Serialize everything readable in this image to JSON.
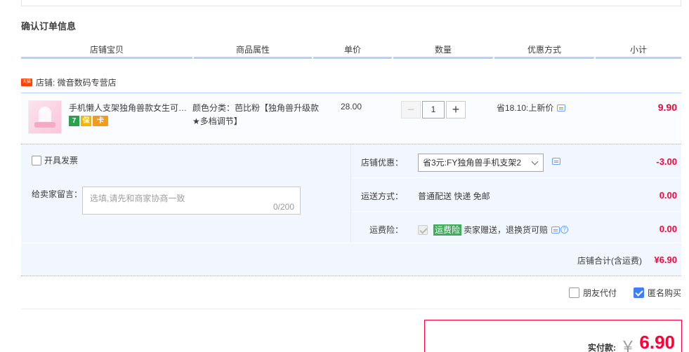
{
  "section_title": "确认订单信息",
  "columns": [
    "店铺宝贝",
    "商品属性",
    "单价",
    "数量",
    "优惠方式",
    "小计"
  ],
  "shop": {
    "badge": "天猫",
    "label": "店铺: 微音数码专营店"
  },
  "item": {
    "title": "手机懒人支架独角兽款女生可爱桌面少女心",
    "icons": [
      "7",
      "保",
      "卡"
    ],
    "attributes": "颜色分类：芭比粉【独角兽升级款★多档调节】",
    "price": "28.00",
    "quantity": "1",
    "discount": "省18.10:上新价",
    "subtotal": "9.90"
  },
  "invoice_label": "开具发票",
  "message": {
    "label": "给卖家留言：",
    "placeholder": "选填,请先和商家协商一致",
    "count": "0/200"
  },
  "shop_discount": {
    "label": "店铺优惠：",
    "selected": "省3元:FY独角兽手机支架2",
    "amount": "-3.00"
  },
  "shipping": {
    "label": "运送方式：",
    "value": "普通配送 快递 免邮",
    "amount": "0.00"
  },
  "insurance": {
    "label": "运费险：",
    "badge": "运费险",
    "value": "卖家赠送，退换货可赔",
    "help": "?",
    "amount": "0.00"
  },
  "shop_total": {
    "label": "店铺合计(含运费)",
    "value": "¥6.90"
  },
  "options": {
    "friend_pay": "朋友代付",
    "anonymous": "匿名购买"
  },
  "pay": {
    "label": "实付款:",
    "currency": "￥",
    "value": "6.90"
  }
}
